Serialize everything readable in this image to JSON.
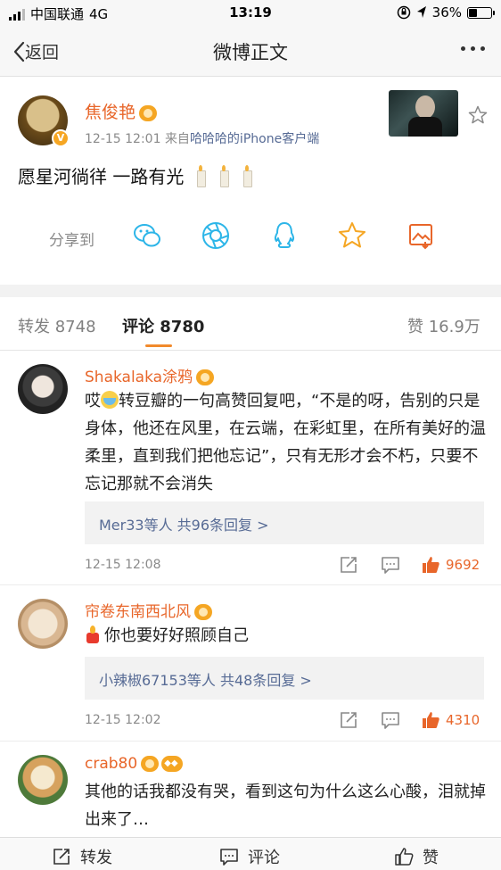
{
  "status_bar": {
    "carrier": "中国联通",
    "network": "4G",
    "time": "13:19",
    "battery": "36%",
    "battery_level": 0.36
  },
  "nav": {
    "back_label": "返回",
    "title": "微博正文"
  },
  "post": {
    "author": "焦俊艳",
    "time": "12-15 12:01",
    "source_prefix": "来自",
    "source": "哈哈哈的iPhone客户端",
    "text": "愿星河徜徉 一路有光",
    "share_label": "分享到"
  },
  "tabs": {
    "repost": "转发 8748",
    "comments": "评论 8780",
    "likes": "赞 16.9万"
  },
  "comments": [
    {
      "name": "Shakalaka涂鸦",
      "text_pre": "哎",
      "text_post": "转豆瓣的一句高赞回复吧，“不是的呀，告别的只是身体，他还在风里，在云端，在彩虹里，在所有美好的温柔里，直到我们把他忘记”，只有无形才会不朽，只要不忘记那就不会消失",
      "replies": "Mer33等人 共96条回复 >",
      "time": "12-15 12:08",
      "likes": "9692"
    },
    {
      "name": "帘卷东南西北风",
      "text": "你也要好好照顾自己",
      "replies": "小辣椒67153等人 共48条回复 >",
      "time": "12-15 12:02",
      "likes": "4310"
    },
    {
      "name": "crab80",
      "text": "其他的话我都没有哭，看到这句为什么这么心酸，泪就掉出来了…"
    }
  ],
  "bottom_bar": {
    "repost": "转发",
    "comment": "评论",
    "like": "赞"
  },
  "colors": {
    "accent": "#e8662a",
    "link": "#576b95",
    "tab_indicator": "#f18a2c"
  }
}
